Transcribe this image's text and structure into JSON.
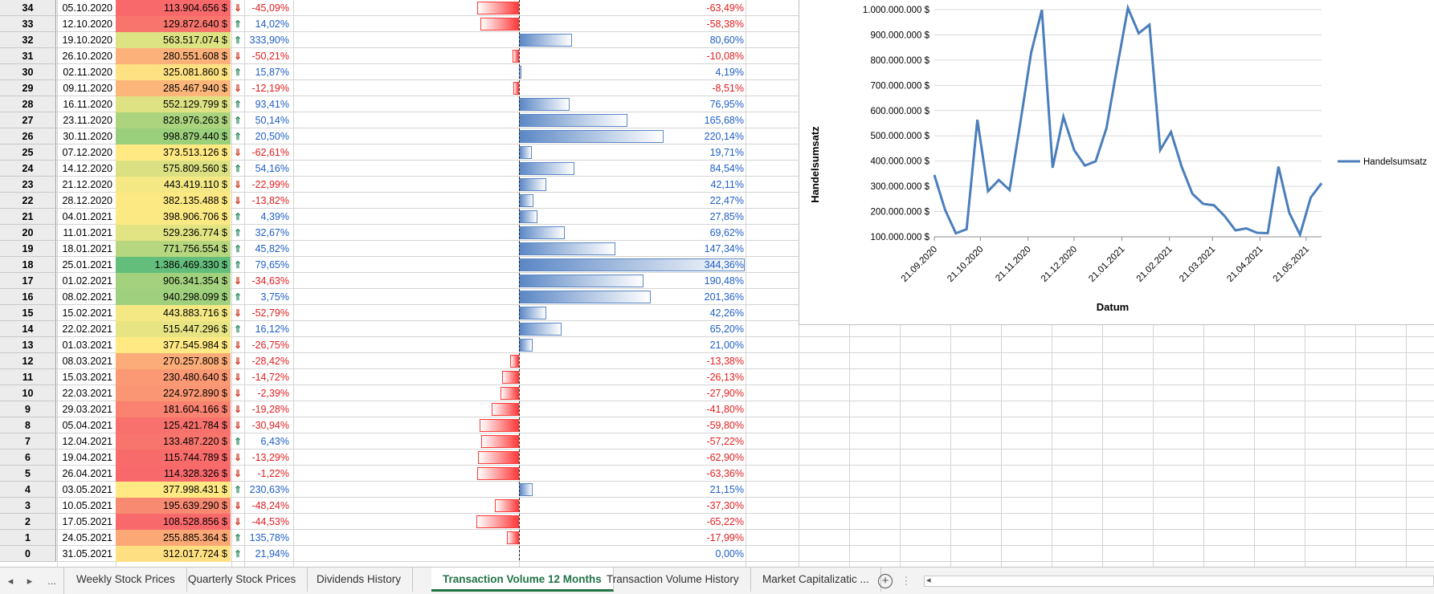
{
  "rows": [
    {
      "n": "34",
      "date": "05.10.2020",
      "vol": "113.904.656 $",
      "dir": "down",
      "chg": "-45,09%",
      "pct": "-63,49%",
      "val": -63.49,
      "color": "#f8696b"
    },
    {
      "n": "33",
      "date": "12.10.2020",
      "vol": "129.872.640 $",
      "dir": "up",
      "chg": "14,02%",
      "pct": "-58,38%",
      "val": -58.38,
      "color": "#f8756d"
    },
    {
      "n": "32",
      "date": "19.10.2020",
      "vol": "563.517.074 $",
      "dir": "up",
      "chg": "333,90%",
      "pct": "80,60%",
      "val": 80.6,
      "color": "#dde283"
    },
    {
      "n": "31",
      "date": "26.10.2020",
      "vol": "280.551.608 $",
      "dir": "down",
      "chg": "-50,21%",
      "pct": "-10,08%",
      "val": -10.08,
      "color": "#fbb179"
    },
    {
      "n": "30",
      "date": "02.11.2020",
      "vol": "325.081.860 $",
      "dir": "up",
      "chg": "15,87%",
      "pct": "4,19%",
      "val": 4.19,
      "color": "#fee182"
    },
    {
      "n": "29",
      "date": "09.11.2020",
      "vol": "285.467.940 $",
      "dir": "down",
      "chg": "-12,19%",
      "pct": "-8,51%",
      "val": -8.51,
      "color": "#fcb67a"
    },
    {
      "n": "28",
      "date": "16.11.2020",
      "vol": "552.129.799 $",
      "dir": "up",
      "chg": "93,41%",
      "pct": "76,95%",
      "val": 76.95,
      "color": "#dee283"
    },
    {
      "n": "27",
      "date": "23.11.2020",
      "vol": "828.976.263 $",
      "dir": "up",
      "chg": "50,14%",
      "pct": "165,68%",
      "val": 165.68,
      "color": "#acd47e"
    },
    {
      "n": "26",
      "date": "30.11.2020",
      "vol": "998.879.440 $",
      "dir": "up",
      "chg": "20,50%",
      "pct": "220,14%",
      "val": 220.14,
      "color": "#9acf7c"
    },
    {
      "n": "25",
      "date": "07.12.2020",
      "vol": "373.513.126 $",
      "dir": "down",
      "chg": "-62,61%",
      "pct": "19,71%",
      "val": 19.71,
      "color": "#fee983"
    },
    {
      "n": "24",
      "date": "14.12.2020",
      "vol": "575.809.560 $",
      "dir": "up",
      "chg": "54,16%",
      "pct": "84,54%",
      "val": 84.54,
      "color": "#dbe182"
    },
    {
      "n": "23",
      "date": "21.12.2020",
      "vol": "443.419.110 $",
      "dir": "down",
      "chg": "-22,99%",
      "pct": "42,11%",
      "val": 42.11,
      "color": "#f3e884"
    },
    {
      "n": "22",
      "date": "28.12.2020",
      "vol": "382.135.488 $",
      "dir": "down",
      "chg": "-13,82%",
      "pct": "22,47%",
      "val": 22.47,
      "color": "#fde983"
    },
    {
      "n": "21",
      "date": "04.01.2021",
      "vol": "398.906.706 $",
      "dir": "up",
      "chg": "4,39%",
      "pct": "27,85%",
      "val": 27.85,
      "color": "#fbe983"
    },
    {
      "n": "20",
      "date": "11.01.2021",
      "vol": "529.236.774 $",
      "dir": "up",
      "chg": "32,67%",
      "pct": "69,62%",
      "val": 69.62,
      "color": "#e2e383"
    },
    {
      "n": "19",
      "date": "18.01.2021",
      "vol": "771.756.554 $",
      "dir": "up",
      "chg": "45,82%",
      "pct": "147,34%",
      "val": 147.34,
      "color": "#b6d77f"
    },
    {
      "n": "18",
      "date": "25.01.2021",
      "vol": "1.386.469.330 $",
      "dir": "up",
      "chg": "79,65%",
      "pct": "344,36%",
      "val": 344.36,
      "color": "#63be7b"
    },
    {
      "n": "17",
      "date": "01.02.2021",
      "vol": "906.341.354 $",
      "dir": "down",
      "chg": "-34,63%",
      "pct": "190,48%",
      "val": 190.48,
      "color": "#a3d17d"
    },
    {
      "n": "16",
      "date": "08.02.2021",
      "vol": "940.298.099 $",
      "dir": "up",
      "chg": "3,75%",
      "pct": "201,36%",
      "val": 201.36,
      "color": "#9fd07d"
    },
    {
      "n": "15",
      "date": "15.02.2021",
      "vol": "443.883.716 $",
      "dir": "down",
      "chg": "-52,79%",
      "pct": "42,26%",
      "val": 42.26,
      "color": "#f3e884"
    },
    {
      "n": "14",
      "date": "22.02.2021",
      "vol": "515.447.296 $",
      "dir": "up",
      "chg": "16,12%",
      "pct": "65,20%",
      "val": 65.2,
      "color": "#e6e483"
    },
    {
      "n": "13",
      "date": "01.03.2021",
      "vol": "377.545.984 $",
      "dir": "down",
      "chg": "-26,75%",
      "pct": "21,00%",
      "val": 21.0,
      "color": "#fee983"
    },
    {
      "n": "12",
      "date": "08.03.2021",
      "vol": "270.257.808 $",
      "dir": "down",
      "chg": "-28,42%",
      "pct": "-13,38%",
      "val": -13.38,
      "color": "#fcac78"
    },
    {
      "n": "11",
      "date": "15.03.2021",
      "vol": "230.480.640 $",
      "dir": "down",
      "chg": "-14,72%",
      "pct": "-26,13%",
      "val": -26.13,
      "color": "#fa9974"
    },
    {
      "n": "10",
      "date": "22.03.2021",
      "vol": "224.972.890 $",
      "dir": "down",
      "chg": "-2,39%",
      "pct": "-27,90%",
      "val": -27.9,
      "color": "#fa9674"
    },
    {
      "n": "9",
      "date": "29.03.2021",
      "vol": "181.604.166 $",
      "dir": "down",
      "chg": "-19,28%",
      "pct": "-41,80%",
      "val": -41.8,
      "color": "#f98270"
    },
    {
      "n": "8",
      "date": "05.04.2021",
      "vol": "125.421.784 $",
      "dir": "down",
      "chg": "-30,94%",
      "pct": "-59,80%",
      "val": -59.8,
      "color": "#f8716c"
    },
    {
      "n": "7",
      "date": "12.04.2021",
      "vol": "133.487.220 $",
      "dir": "up",
      "chg": "6,43%",
      "pct": "-57,22%",
      "val": -57.22,
      "color": "#f8756d"
    },
    {
      "n": "6",
      "date": "19.04.2021",
      "vol": "115.744.789 $",
      "dir": "down",
      "chg": "-13,29%",
      "pct": "-62,90%",
      "val": -62.9,
      "color": "#f86b6b"
    },
    {
      "n": "5",
      "date": "26.04.2021",
      "vol": "114.328.326 $",
      "dir": "down",
      "chg": "-1,22%",
      "pct": "-63,36%",
      "val": -63.36,
      "color": "#f8696b"
    },
    {
      "n": "4",
      "date": "03.05.2021",
      "vol": "377.998.431 $",
      "dir": "up",
      "chg": "230,63%",
      "pct": "21,15%",
      "val": 21.15,
      "color": "#fee983"
    },
    {
      "n": "3",
      "date": "10.05.2021",
      "vol": "195.639.290 $",
      "dir": "down",
      "chg": "-48,24%",
      "pct": "-37,30%",
      "val": -37.3,
      "color": "#f98a72"
    },
    {
      "n": "2",
      "date": "17.05.2021",
      "vol": "108.528.856 $",
      "dir": "down",
      "chg": "-44,53%",
      "pct": "-65,22%",
      "val": -65.22,
      "color": "#f8696b"
    },
    {
      "n": "1",
      "date": "24.05.2021",
      "vol": "255.885.364 $",
      "dir": "up",
      "chg": "135,78%",
      "pct": "-17,99%",
      "val": -17.99,
      "color": "#fba876"
    },
    {
      "n": "0",
      "date": "31.05.2021",
      "vol": "312.017.724 $",
      "dir": "up",
      "chg": "21,94%",
      "pct": "0,00%",
      "val": 0.0,
      "color": "#fee082"
    }
  ],
  "colors": {
    "up_arrow": "#2d8a63",
    "down_arrow": "#d0402a",
    "pos_text": "#1f5fc4",
    "neg_text": "#e02020",
    "series": "#4a7ebb",
    "active_tab": "#217346"
  },
  "icons": {
    "up": "arrow-up-icon",
    "down": "arrow-down-icon"
  },
  "chart_data": {
    "type": "line",
    "ylabel": "Handelsumsatz",
    "xlabel": "Datum",
    "yticks": [
      "100.000.000 $",
      "200.000.000 $",
      "300.000.000 $",
      "400.000.000 $",
      "500.000.000 $",
      "600.000.000 $",
      "700.000.000 $",
      "800.000.000 $",
      "900.000.000 $",
      "1.000.000.000 $"
    ],
    "xticks": [
      "21.09.2020",
      "21.10.2020",
      "21.11.2020",
      "21.12.2020",
      "21.01.2021",
      "21.02.2021",
      "21.03.2021",
      "21.04.2021",
      "21.05.2021"
    ],
    "ylim": [
      100000000,
      1000000000
    ],
    "legend": "right",
    "series": [
      {
        "name": "Handelsumsatz",
        "x": [
          "2020-09-21",
          "2020-09-28",
          "2020-10-05",
          "2020-10-12",
          "2020-10-19",
          "2020-10-26",
          "2020-11-02",
          "2020-11-09",
          "2020-11-16",
          "2020-11-23",
          "2020-11-30",
          "2020-12-07",
          "2020-12-14",
          "2020-12-21",
          "2020-12-28",
          "2021-01-04",
          "2021-01-11",
          "2021-01-18",
          "2021-01-25",
          "2021-02-01",
          "2021-02-08",
          "2021-02-15",
          "2021-02-22",
          "2021-03-01",
          "2021-03-08",
          "2021-03-15",
          "2021-03-22",
          "2021-03-29",
          "2021-04-05",
          "2021-04-12",
          "2021-04-19",
          "2021-04-26",
          "2021-05-03",
          "2021-05-10",
          "2021-05-17",
          "2021-05-24",
          "2021-05-31"
        ],
        "values": [
          345000000,
          207000000,
          113904656,
          129872640,
          563517074,
          280551608,
          325081860,
          285467940,
          552129799,
          828976263,
          998879440,
          373513126,
          575809560,
          443419110,
          382135488,
          398906706,
          529236774,
          771756554,
          1386469330,
          906341354,
          940298099,
          443883716,
          515447296,
          377545984,
          270257808,
          230480640,
          224972890,
          181604166,
          125421784,
          133487220,
          115744789,
          114328326,
          377998431,
          195639290,
          108528856,
          255885364,
          312017724
        ]
      }
    ]
  },
  "tabs": {
    "nav_prev": "◂",
    "nav_next": "▸",
    "nav_more": "...",
    "items": [
      "Weekly Stock Prices",
      "Quarterly Stock Prices",
      "Dividends History",
      "Transaction Volume 12 Months",
      "Transaction Volume History",
      "Market Capitalizatic ..."
    ],
    "active": 3,
    "add": "+",
    "sep": "⋮",
    "scroll_left": "◂"
  }
}
